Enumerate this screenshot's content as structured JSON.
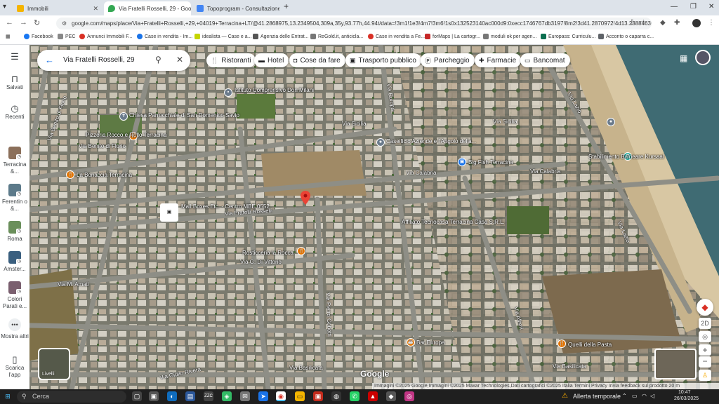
{
  "browser": {
    "tabs": [
      {
        "label": "Immobili",
        "favicon_color": "#f4b400"
      },
      {
        "label": "Via Fratelli Rosselli, 29 - Google",
        "favicon_color": "#34a853",
        "active": true
      },
      {
        "label": "Topoprogram - Consultazione",
        "favicon_color": "#4285f4"
      }
    ],
    "url": "google.com/maps/place/Via+Fratelli+Rosselli,+29,+04019+Terracina+LT/@41.2868975,13.2349504,309a,35y,93.77h,44.94t/data=!3m1!1e3!4m7!3m6!1s0x132523140ac000d9:0xecc1746767db3197!8m2!3d41.2870972!4d13.2388463!16s%2F",
    "bookmarks": [
      {
        "label": "Facebook",
        "color": "#1877f2"
      },
      {
        "label": "PEC",
        "color": "#888888"
      },
      {
        "label": "Annunci Immobili F...",
        "color": "#d93025"
      },
      {
        "label": "Case in vendita - Im...",
        "color": "#1a73e8"
      },
      {
        "label": "idealista — Case e a...",
        "color": "#c5d500"
      },
      {
        "label": "Agenzia delle Entrat...",
        "color": "#555555"
      },
      {
        "label": "ReGold.it, anticicla...",
        "color": "#777777"
      },
      {
        "label": "Case in vendita a Fe...",
        "color": "#d93025"
      },
      {
        "label": "forMaps | La cartogr...",
        "color": "#c62828"
      },
      {
        "label": "moduli ok per agen...",
        "color": "#777777"
      },
      {
        "label": "Europass: Curriculu...",
        "color": "#0b6e4f"
      },
      {
        "label": "Acconto o caparra c...",
        "color": "#5f6368"
      }
    ]
  },
  "rail": {
    "menu_label": "Menu",
    "saved": "Salvati",
    "recent": "Recenti",
    "recents": [
      {
        "label": "Terracina &...",
        "color": "#8b6f5a"
      },
      {
        "label": "Ferentin o &...",
        "color": "#5c7a8a"
      },
      {
        "label": "Roma",
        "color": "#6a8f5b"
      },
      {
        "label": "Amster...",
        "color": "#3a5f7f"
      },
      {
        "label": "Colori Parati e...",
        "color": "#7a5f6f"
      }
    ],
    "more": "Mostra altri",
    "app": "Scarica l'app"
  },
  "search": {
    "value": "Via Fratelli Rosselli, 29"
  },
  "chips": [
    {
      "label": "Ristoranti",
      "icon": "fork-icon"
    },
    {
      "label": "Hotel",
      "icon": "bed-icon"
    },
    {
      "label": "Cose da fare",
      "icon": "camera-icon"
    },
    {
      "label": "Trasporto pubblico",
      "icon": "bus-icon"
    },
    {
      "label": "Parcheggio",
      "icon": "parking-icon"
    },
    {
      "label": "Farmacie",
      "icon": "pharmacy-icon"
    },
    {
      "label": "Bancomat",
      "icon": "atm-icon"
    }
  ],
  "map": {
    "places": {
      "istituto": "Istituto Comprensivo Don Milani",
      "chiesa": "Chiesa Parrocchiale di San Domenico Savio",
      "pizzeria": "Pizzeria Rocco e Rollo Terracina",
      "bonaccia": "La Bonaccia Terracina",
      "mail": "Mail Boxes Etc. - Centro MBE 0552",
      "caseificio": "Caseificio Aziende e l'Angolo della...",
      "bigfish": "Big Fish Terracina",
      "stabilimento": "Stabilimento Balneare Kursaal",
      "affiliato": "Affiliato Tecnocasa Terracina Casa S.R.L.",
      "rosticceria": "Rosticceria la Rocca",
      "bareuropa": "Bar Europa",
      "quelli": "Quelli della Pasta"
    },
    "streets": {
      "sicilia": "Via Sicilia",
      "sicilia2": "Via Sicilia",
      "calabria": "Via Calabria",
      "calabria2": "Via Calabria",
      "rosselli": "Via Fratelli Rosselli",
      "vittorio": "Via G. Di Vittorio",
      "amati": "Via M. Amati",
      "basilicata": "Via Basilicata",
      "basilicata2": "Via Basilicata",
      "rivera": "Via Giulio Rivera",
      "benito": "Via Benito di Florio",
      "benito2": "Via Benito di Florio",
      "europa": "Via Europa",
      "lazio": "Via Lazio",
      "pietro": "Via Pietro Gobetti",
      "alfieri": "Via Alfieri",
      "lasta": "Via Lazio"
    },
    "layers": "Livelli",
    "google": "Google",
    "attribution": "Immagini ©2025 Google,Immagini ©2025 Maxar Technologies,Dati cartografici ©2025   Italia   Termini   Privacy   Invia feedback sul prodotto   20 m",
    "view_mode": "2D"
  },
  "taskbar": {
    "search": "Cerca",
    "weather": "Allerta temporale",
    "time": "10:47",
    "date": "26/03/2025"
  }
}
